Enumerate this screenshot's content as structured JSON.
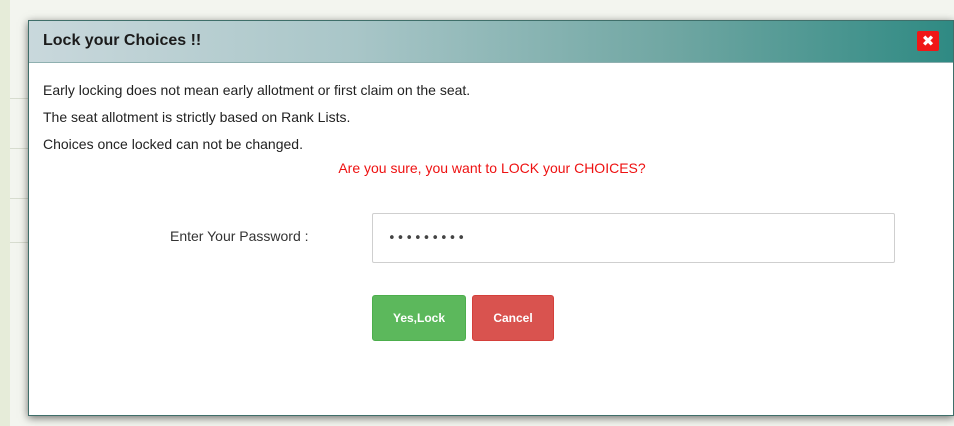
{
  "dialog": {
    "title": "Lock your Choices !!",
    "close_glyph": "✖",
    "messages": [
      "Early locking does not mean early allotment or first claim on the seat.",
      "The seat allotment is strictly based on Rank Lists.",
      "Choices once locked can not be changed."
    ],
    "warning": "Are you sure, you want to LOCK your CHOICES?",
    "password_label": "Enter Your Password :",
    "password_value": "•••••••••",
    "lock_button": "Yes,Lock",
    "cancel_button": "Cancel",
    "colors": {
      "warning": "#ee1111",
      "lock_button": "#5cb85c",
      "cancel_button": "#d9534f",
      "close_button": "#f01717"
    }
  }
}
